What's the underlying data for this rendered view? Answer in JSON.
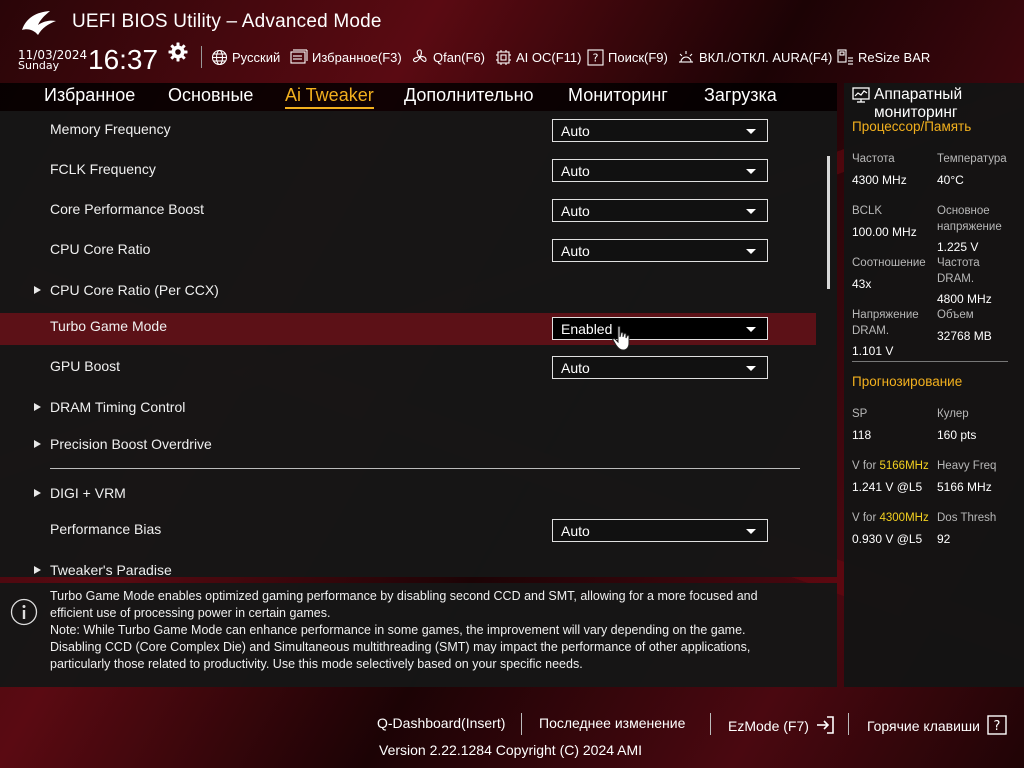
{
  "header": {
    "title": "UEFI BIOS Utility – Advanced Mode",
    "date": "11/03/2024",
    "day": "Sunday",
    "time": "16:37"
  },
  "toolbar": [
    {
      "label": "Русский",
      "icon": "globe-icon"
    },
    {
      "label": "Избранное(F3)",
      "icon": "favorites-icon"
    },
    {
      "label": "Qfan(F6)",
      "icon": "fan-icon"
    },
    {
      "label": "AI OC(F11)",
      "icon": "ai-chip-icon"
    },
    {
      "label": "Поиск(F9)",
      "icon": "help-search-icon"
    },
    {
      "label": "ВКЛ./ОТКЛ. AURA(F4)",
      "icon": "aura-light-icon"
    },
    {
      "label": "ReSize BAR",
      "icon": "resize-bar-icon"
    }
  ],
  "tabs": [
    "Избранное",
    "Основные",
    "Ai Tweaker",
    "Дополнительно",
    "Мониторинг",
    "Загрузка"
  ],
  "active_tab": "Ai Tweaker",
  "settings": [
    {
      "label": "Memory Frequency",
      "value": "Auto"
    },
    {
      "label": "FCLK Frequency",
      "value": "Auto"
    },
    {
      "label": "Core Performance Boost",
      "value": "Auto"
    },
    {
      "label": "CPU Core Ratio",
      "value": "Auto"
    },
    {
      "label": "CPU Core Ratio (Per CCX)",
      "submenu": true
    },
    {
      "label": "Turbo Game Mode",
      "value": "Enabled",
      "selected": true
    },
    {
      "label": "GPU Boost",
      "value": "Auto"
    },
    {
      "label": "DRAM Timing Control",
      "submenu": true
    },
    {
      "label": "Precision Boost Overdrive",
      "submenu": true
    },
    {
      "label": "DIGI + VRM",
      "submenu": true
    },
    {
      "label": "Performance Bias",
      "value": "Auto"
    },
    {
      "label": "Tweaker's Paradise",
      "submenu": true
    }
  ],
  "help_text": [
    "Turbo Game Mode enables optimized gaming performance by disabling second CCD and SMT, allowing for a more focused and",
    "efficient use of processing power in certain games.",
    "Note: While Turbo Game Mode can enhance performance in some games, the improvement will vary depending on the game.",
    "Disabling CCD (Core Complex Die) and Simultaneous multithreading (SMT) may impact the performance of other applications,",
    "particularly those related to productivity. Use this mode selectively based on your specific needs."
  ],
  "hw_monitor": {
    "title_line1": "Аппаратный",
    "title_line2": "мониторинг",
    "cpu_mem_title": "Процессор/Память",
    "items": [
      {
        "label": [
          "Частота"
        ],
        "value": "4300 MHz"
      },
      {
        "label": [
          "Температура"
        ],
        "value": "40°C"
      },
      {
        "label": [
          "BCLK"
        ],
        "value": "100.00 MHz"
      },
      {
        "label": [
          "Основное",
          "напряжение"
        ],
        "value": "1.225 V"
      },
      {
        "label": [
          "Соотношение"
        ],
        "value": "43x"
      },
      {
        "label": [
          "Частота",
          "DRAM."
        ],
        "value": "4800 MHz"
      },
      {
        "label": [
          "Напряжение",
          "DRAM."
        ],
        "value": "1.101 V"
      },
      {
        "label": [
          "Объем"
        ],
        "value": "32768 MB"
      }
    ],
    "forecast_title": "Прогнозирование",
    "forecast": [
      {
        "label": "SP",
        "value": "118"
      },
      {
        "label": "Кулер",
        "value": "160 pts"
      },
      {
        "label_prefix": "V for ",
        "label_hl": "5166MHz",
        "value": "1.241 V @L5"
      },
      {
        "label": "Heavy Freq",
        "value": "5166 MHz"
      },
      {
        "label_prefix": "V for ",
        "label_hl": "4300MHz",
        "value": "0.930 V @L5"
      },
      {
        "label": "Dos Thresh",
        "value": "92"
      }
    ]
  },
  "footer": {
    "qdashboard": "Q-Dashboard(Insert)",
    "last_change": "Последнее изменение",
    "ezmode": "EzMode (F7)",
    "hotkeys": "Горячие клавиши",
    "version": "Version 2.22.1284 Copyright (C) 2024 AMI"
  },
  "colors": {
    "accent": "#f2b01e",
    "highlight_value": "#f2d020",
    "selected_row": "#5c1117"
  }
}
